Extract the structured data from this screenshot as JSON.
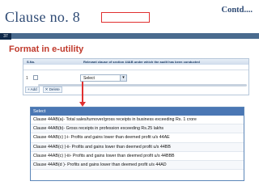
{
  "slide": {
    "title": "Clause no. 8",
    "contd": "Contd....",
    "page_number": "37",
    "subtitle": "Format in e-utility"
  },
  "grid": {
    "col_sno": "S.No.",
    "col_heading": "Relevant clause of section 44AB under which the audit has been conducted",
    "row_number": "1",
    "select_value": "Select",
    "add_label": "Add",
    "delete_label": "Delete"
  },
  "dropdown": {
    "header": "Select",
    "options": [
      "Clause 44AB(a)- Total sales/turnover/gross receipts in business exceeding Rs. 1 crore",
      "Clause 44AB(b)- Gross receipts in profession exceeding Rs.25 lakhs",
      "Clause 44AB(c) )-i- Profits and gains lower than deemed profit u/s 44AE",
      "Clause 44AB(c) )-ii- Profits and gains lower than deemed profit u/s 44BB",
      "Clause 44AB(c) )-iii- Profits and gains lower than deemed profit u/s 44BBB",
      "Clause 44AB(d )- Profits and gains lower than deemed profit u/s 44AD"
    ]
  },
  "colors": {
    "title": "#2e4a74",
    "subtitle": "#c0392b",
    "bar": "#4a6b8e",
    "highlight": "#e03030",
    "dropdown_header": "#4a77b4"
  }
}
